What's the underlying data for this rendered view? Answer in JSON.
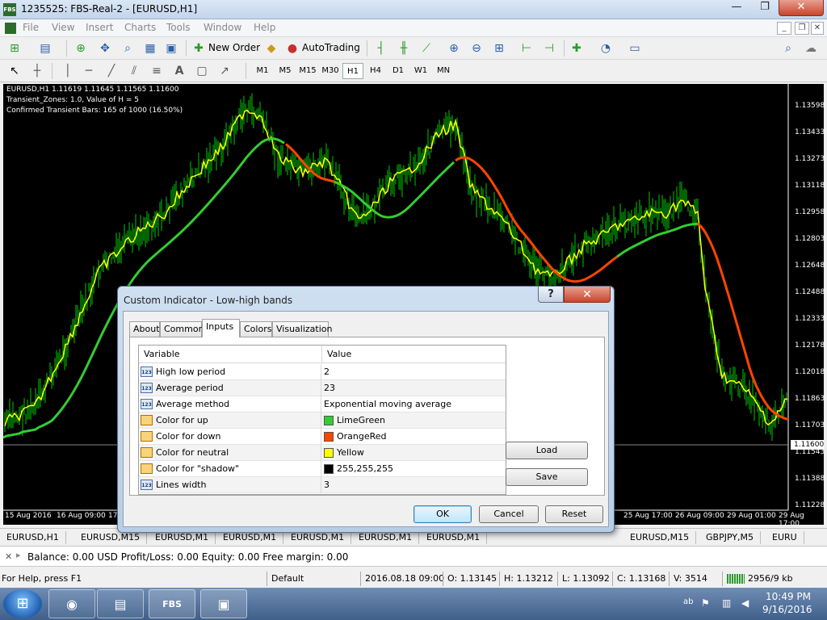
{
  "window": {
    "title": "1235525: FBS-Real-2 - [EURUSD,H1]",
    "app_icon_text": "FBS",
    "min": "—",
    "max": "❐",
    "close": "✕"
  },
  "menu": {
    "items": [
      "File",
      "View",
      "Insert",
      "Charts",
      "Tools",
      "Window",
      "Help"
    ],
    "mdi_min": "_",
    "mdi_restore": "❐",
    "mdi_close": "✕"
  },
  "toolbar": {
    "new_order": "New Order",
    "autotrading": "AutoTrading"
  },
  "timeframes": [
    "M1",
    "M5",
    "M15",
    "M30",
    "H1",
    "H4",
    "D1",
    "W1",
    "MN"
  ],
  "active_timeframe": "H1",
  "chart": {
    "info_line1": "EURUSD,H1  1.11619 1.11645 1.11565 1.11600",
    "info_line2": "Transient_Zones: 1.0, Value of H = 5",
    "info_line3": "Confirmed Transient Bars: 165 of 1000 (16.50%)",
    "price_labels": [
      "1.13598",
      "1.13433",
      "1.13273",
      "1.13118",
      "1.12958",
      "1.12803",
      "1.12648",
      "1.12488",
      "1.12333",
      "1.12178",
      "1.12018",
      "1.11863",
      "1.11703",
      "1.11543",
      "1.11388",
      "1.11228"
    ],
    "current_price": "1.11600",
    "date_labels": [
      "15 Aug 2016",
      "16 Aug 09:00",
      "17",
      "25 Aug 17:00",
      "26 Aug 09:00",
      "29 Aug 01:00",
      "29 Aug 17:00"
    ],
    "colors": {
      "up": "#32CD32",
      "down": "#FF4500",
      "neutral": "#FFFF00",
      "bars": "#00c800"
    }
  },
  "chart_tabs": [
    "EURUSD,H1",
    "EURUSD,M15",
    "EURUSD,M1",
    "EURUSD,M1",
    "EURUSD,M1",
    "EURUSD,M1",
    "EURUSD,M1",
    "EURUSD,M15",
    "GBPJPY,M5",
    "EURU"
  ],
  "terminal": {
    "text": "Balance: 0.00 USD  Profit/Loss: 0.00  Equity: 0.00  Free margin: 0.00"
  },
  "statusbar": {
    "help": "For Help, press F1",
    "profile": "Default",
    "datetime": "2016.08.18 09:00",
    "open": "O: 1.13145",
    "high": "H: 1.13212",
    "low": "L: 1.13092",
    "close": "C: 1.13168",
    "volume": "V: 3514",
    "traffic": "2956/9 kb"
  },
  "taskbar": {
    "time": "10:49 PM",
    "date": "9/16/2016",
    "task_fbs": "FBS"
  },
  "dialog": {
    "title": "Custom Indicator - Low-high bands",
    "help": "?",
    "close": "✕",
    "tabs": [
      "About",
      "Common",
      "Inputs",
      "Colors",
      "Visualization"
    ],
    "active_tab": "Inputs",
    "columns": [
      "Variable",
      "Value"
    ],
    "rows": [
      {
        "name": "High low period",
        "value": "2",
        "type": "123",
        "color": null
      },
      {
        "name": "Average period",
        "value": "23",
        "type": "123",
        "color": null
      },
      {
        "name": "Average method",
        "value": "Exponential moving average",
        "type": "123",
        "color": null
      },
      {
        "name": "Color for up",
        "value": "LimeGreen",
        "type": "color",
        "color": "#32CD32"
      },
      {
        "name": "Color for down",
        "value": "OrangeRed",
        "type": "color",
        "color": "#FF4500"
      },
      {
        "name": "Color for neutral",
        "value": "Yellow",
        "type": "color",
        "color": "#FFFF00"
      },
      {
        "name": "Color for \"shadow\"",
        "value": "255,255,255",
        "type": "color",
        "color": "#000000"
      },
      {
        "name": "Lines width",
        "value": "3",
        "type": "123",
        "color": null
      }
    ],
    "buttons": {
      "load": "Load",
      "save": "Save",
      "ok": "OK",
      "cancel": "Cancel",
      "reset": "Reset"
    }
  }
}
